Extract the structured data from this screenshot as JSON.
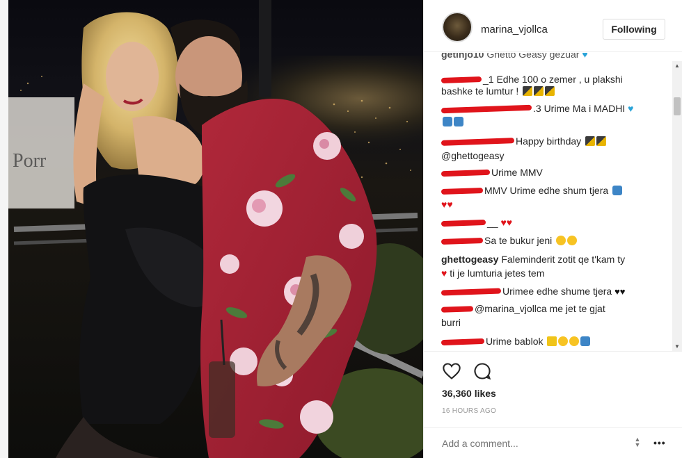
{
  "header": {
    "username": "marina_vjollca",
    "follow_label": "Following"
  },
  "comments": [
    {
      "user": "getinjo10",
      "text": "Ghetto Geasy gezuar"
    },
    {
      "user": "",
      "text": "_1 Edhe 100 o zemer , u plakshi"
    },
    {
      "user": "",
      "text": "bashke te lumtur !"
    },
    {
      "user": "",
      "text": ".3 Urime Ma i MADHI"
    },
    {
      "user": "",
      "text": "Happy birthday"
    },
    {
      "user": "",
      "text": "@ghettogeasy"
    },
    {
      "user": "",
      "text": "Urime MMV"
    },
    {
      "user": "",
      "text": "MMV Urime edhe shum tjera"
    },
    {
      "user": "",
      "text": "__"
    },
    {
      "user": "",
      "text": "Sa te bukur jeni"
    },
    {
      "user": "ghettogeasy",
      "text": "Faleminderit zotit qe t'kam ty"
    },
    {
      "user": "",
      "text": "ti je lumturia jetes tem"
    },
    {
      "user": "",
      "text": "Urimee edhe shume tjera"
    },
    {
      "user": "",
      "text": "@marina_vjollca me jet te gjat"
    },
    {
      "user": "",
      "text": "burri"
    },
    {
      "user": "",
      "text": "Urime bablok"
    }
  ],
  "icons": {
    "like": "heart-outline-icon",
    "comment": "comment-bubble-icon",
    "more": "more-options-icon"
  },
  "stats": {
    "likes": "36,360 likes",
    "time": "16 HOURS AGO"
  },
  "add_comment": {
    "placeholder": "Add a comment...",
    "more_label": "•••"
  },
  "colors": {
    "redaction": "#e0141b",
    "text": "#262626",
    "muted": "#999999"
  }
}
